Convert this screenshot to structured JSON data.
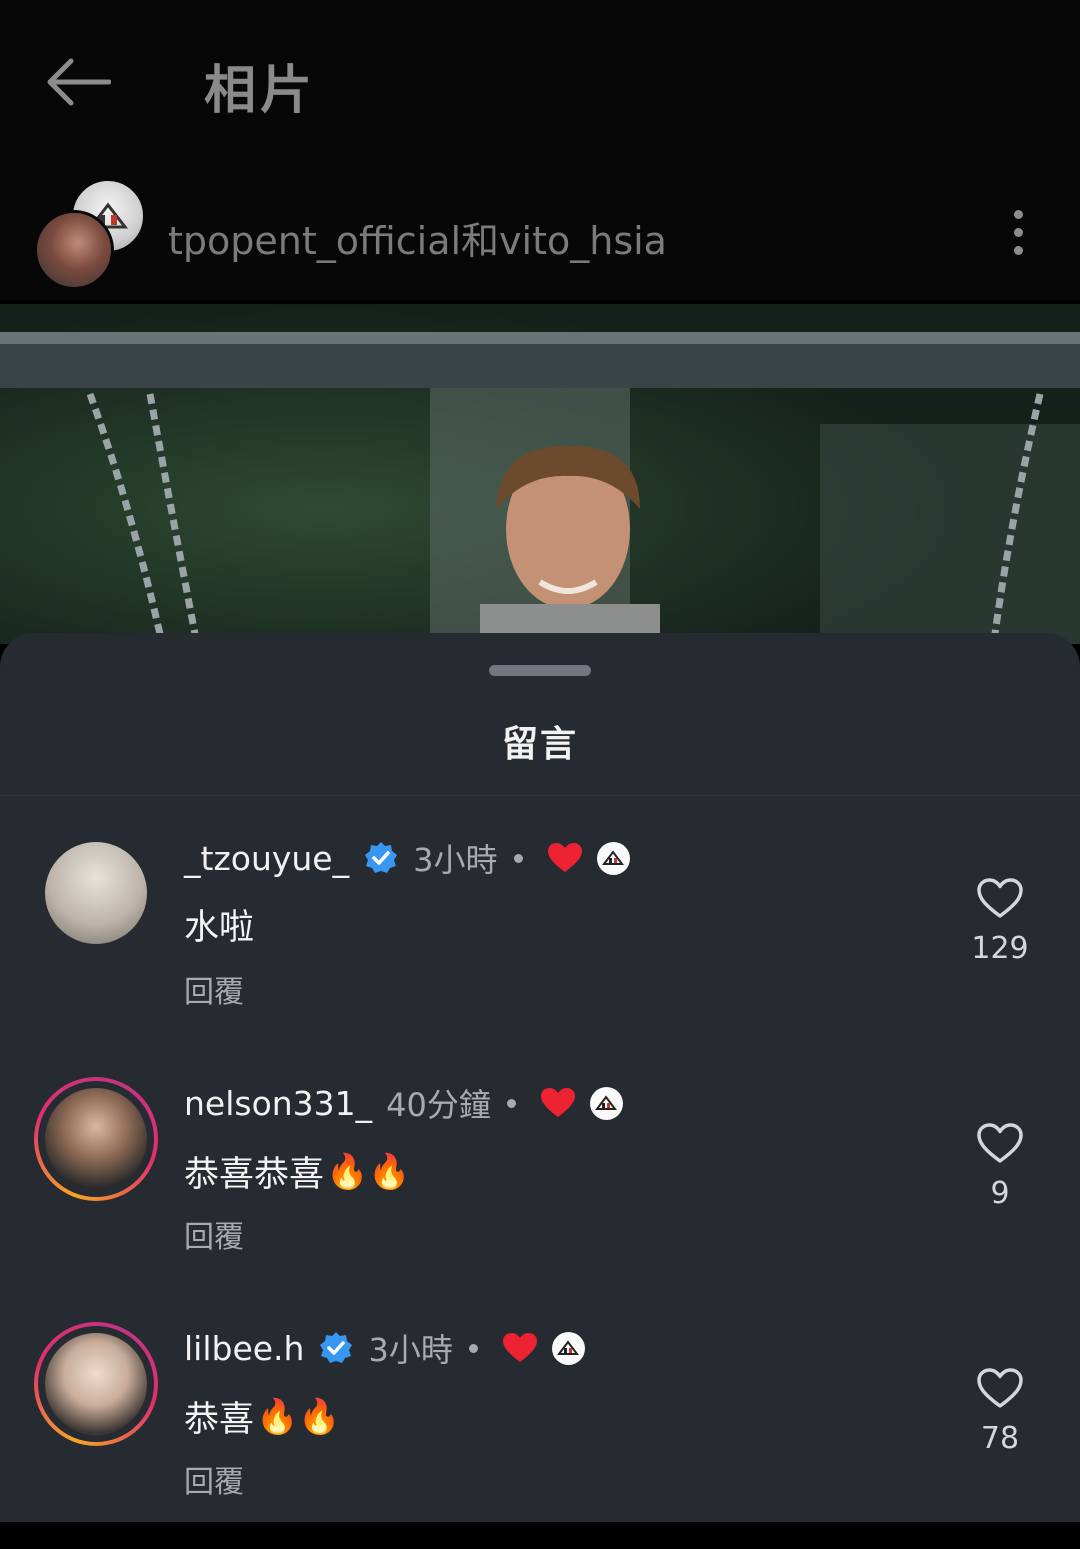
{
  "header": {
    "title": "相片",
    "post_author": "tpopent_official和vito_hsia"
  },
  "comments_sheet": {
    "title": "留言"
  },
  "comments": [
    {
      "username": "_tzouyue_",
      "verified": true,
      "time": "3小時",
      "text": "水啦",
      "emoji": "",
      "reply_label": "回覆",
      "likes": "129"
    },
    {
      "username": "nelson331_",
      "verified": false,
      "time": "40分鐘",
      "text": "恭喜恭喜",
      "emoji": "🔥🔥",
      "reply_label": "回覆",
      "likes": "9"
    },
    {
      "username": "lilbee.h",
      "verified": true,
      "time": "3小時",
      "text": "恭喜",
      "emoji": "🔥🔥",
      "reply_label": "回覆",
      "likes": "78"
    }
  ],
  "colors": {
    "verified": "#3897f0",
    "creator_heart": "#ed2233",
    "sheet_background": "#262a31"
  },
  "icons": [
    "back-arrow-icon",
    "more-options-icon",
    "verified-badge-icon",
    "creator-liked-heart-icon",
    "like-heart-icon"
  ]
}
